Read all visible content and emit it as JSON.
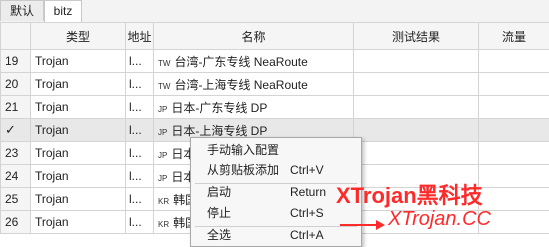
{
  "tabs": [
    {
      "label": "默认"
    },
    {
      "label": "bitz"
    }
  ],
  "columns": {
    "type": "类型",
    "address": "地址",
    "name": "名称",
    "test_result": "测试结果",
    "traffic": "流量"
  },
  "rows": [
    {
      "idx": "19",
      "type": "Trojan",
      "address": "l...",
      "flag": "TW",
      "name": "台湾-广东专线 NeaRoute"
    },
    {
      "idx": "20",
      "type": "Trojan",
      "address": "l...",
      "flag": "TW",
      "name": "台湾-上海专线 NeaRoute"
    },
    {
      "idx": "21",
      "type": "Trojan",
      "address": "l...",
      "flag": "JP",
      "name": "日本-广东专线 DP"
    },
    {
      "idx": "✓",
      "type": "Trojan",
      "address": "l...",
      "flag": "JP",
      "name": "日本-上海专线 DP"
    },
    {
      "idx": "23",
      "type": "Trojan",
      "address": "l...",
      "flag": "JP",
      "name": "日本"
    },
    {
      "idx": "24",
      "type": "Trojan",
      "address": "l...",
      "flag": "JP",
      "name": "日本"
    },
    {
      "idx": "25",
      "type": "Trojan",
      "address": "l...",
      "flag": "KR",
      "name": "韩国"
    },
    {
      "idx": "26",
      "type": "Trojan",
      "address": "l...",
      "flag": "KR",
      "name": "韩国"
    }
  ],
  "context_menu": {
    "manual_input": "手动输入配置",
    "add_from_clipboard": "从剪贴板添加",
    "add_from_clipboard_shortcut": "Ctrl+V",
    "start": "启动",
    "start_shortcut": "Return",
    "stop": "停止",
    "stop_shortcut": "Ctrl+S",
    "select_all": "全选",
    "select_all_shortcut": "Ctrl+A"
  },
  "watermark": {
    "title": "XTrojan黑科技",
    "url": "XTrojan.CC",
    "color": "#ff2a2a"
  }
}
